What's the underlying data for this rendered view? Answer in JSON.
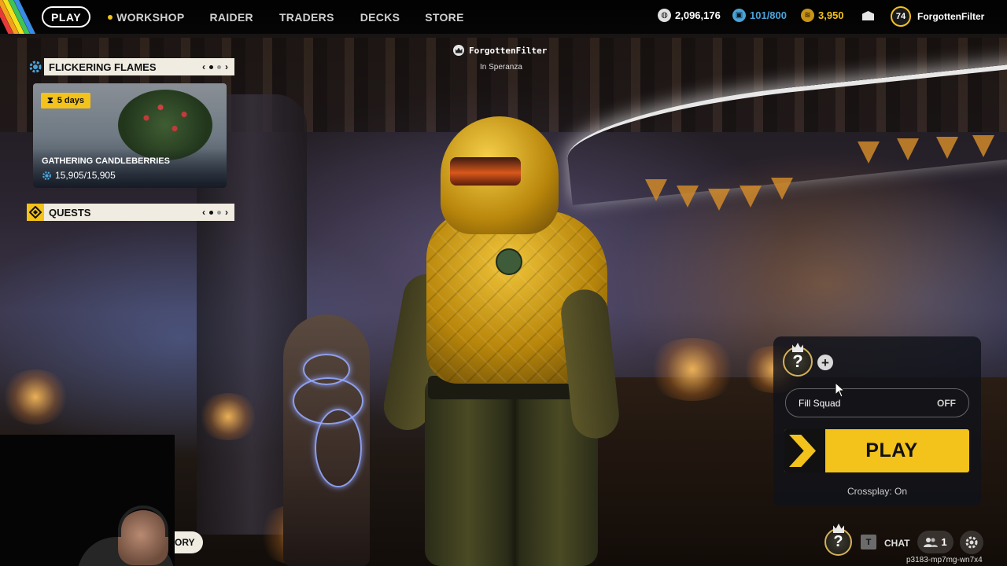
{
  "nav": {
    "play": "PLAY",
    "workshop": "WORKSHOP",
    "raider": "RAIDER",
    "traders": "TRADERS",
    "decks": "DECKS",
    "store": "STORE"
  },
  "currencies": {
    "coins": "2,096,176",
    "capacity": "101/800",
    "tokens": "3,950"
  },
  "profile": {
    "level": "74",
    "username": "ForgottenFilter"
  },
  "event_panel": {
    "title": "FLICKERING FLAMES",
    "timer": "5 days",
    "card_title": "GATHERING CANDLEBERRIES",
    "progress": "15,905/15,905"
  },
  "quests_panel": {
    "title": "QUESTS"
  },
  "center": {
    "player_name": "ForgottenFilter",
    "location": "In Speranza"
  },
  "squad": {
    "fill_squad_label": "Fill Squad",
    "fill_squad_state": "OFF",
    "play_label": "PLAY",
    "crossplay": "Crossplay: On",
    "slot_symbol": "?",
    "add_symbol": "+"
  },
  "bottom": {
    "chat_key": "T",
    "chat_label": "CHAT",
    "friends_count": "1",
    "build_id": "p3183-mp7mg-wn7x4",
    "partial_button": "ORY"
  },
  "colors": {
    "accent": "#f3c21b",
    "panel_header": "#f0ece1",
    "capacity_blue": "#4aa3d8"
  },
  "icons": {
    "workshop": "dot-icon",
    "coins": "coin-icon",
    "capacity": "backpack-icon",
    "tokens": "token-icon",
    "mail": "mail-icon",
    "event": "gear-icon",
    "quests": "quest-diamond-icon",
    "timer": "hourglass-icon",
    "crown": "crown-icon",
    "friends": "people-icon",
    "settings": "gear-icon"
  }
}
